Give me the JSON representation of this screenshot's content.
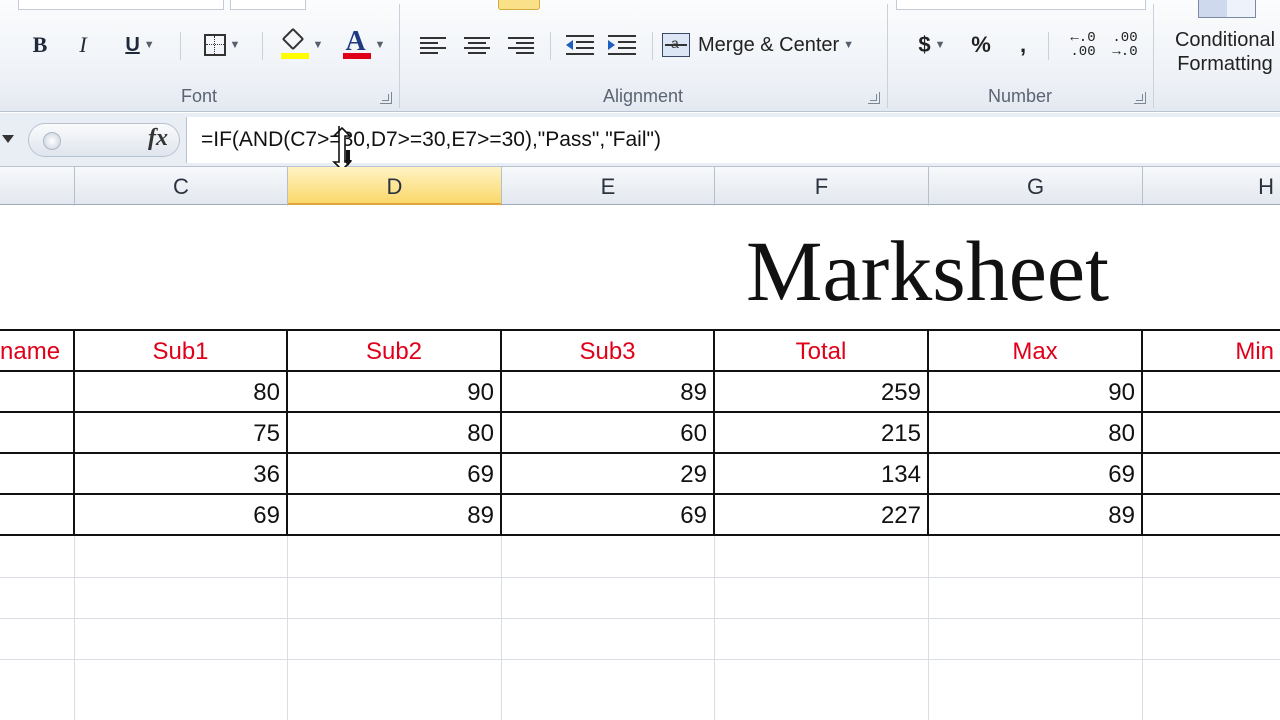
{
  "ribbon": {
    "font_group": {
      "label": "Font",
      "bold": "B",
      "italic": "I",
      "underline": "U",
      "fill_color": "#ffff00",
      "font_color_letter": "A",
      "font_color": "#e0001a"
    },
    "alignment_group": {
      "label": "Alignment",
      "merge_center": "Merge & Center"
    },
    "number_group": {
      "label": "Number",
      "currency": "$",
      "percent": "%",
      "comma": ",",
      "increase_decimal": "←.0\n.00",
      "decrease_decimal": ".00\n→.0"
    },
    "conditional_formatting": "Conditional Formatting"
  },
  "formula_bar": {
    "fx": "fx",
    "formula": "=IF(AND(C7>=30,D7>=30,E7>=30),\"Pass\",\"Fail\")"
  },
  "columns": [
    "C",
    "D",
    "E",
    "F",
    "G",
    "H"
  ],
  "active_column": "D",
  "sheet": {
    "title": "Marksheet",
    "headers": [
      "name",
      "Sub1",
      "Sub2",
      "Sub3",
      "Total",
      "Max",
      "Min"
    ],
    "rows": [
      [
        "80",
        "90",
        "89",
        "259",
        "90"
      ],
      [
        "75",
        "80",
        "60",
        "215",
        "80"
      ],
      [
        "36",
        "69",
        "29",
        "134",
        "69"
      ],
      [
        "69",
        "89",
        "69",
        "227",
        "89"
      ]
    ]
  },
  "colors": {
    "header_text": "#e0001a",
    "active_column_header": "#fbd86b"
  }
}
